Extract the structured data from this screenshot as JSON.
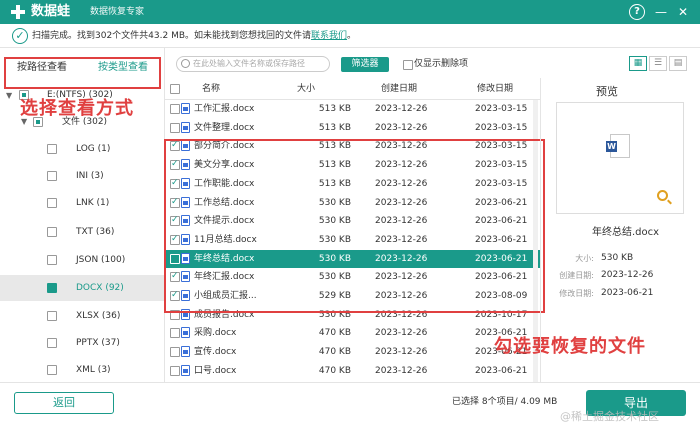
{
  "titlebar": {
    "app_name": "数据蛙",
    "app_sub": "数据恢复专家",
    "help": "?",
    "minimize": "—",
    "close": "✕"
  },
  "status": {
    "check": "✓",
    "text": "扫描完成。找到302个文件共43.2 MB。如未能找到您想找回的文件请",
    "link": "联系我们",
    "end": "。"
  },
  "tabs": {
    "by_path": "按路径查看",
    "by_type": "按类型查看"
  },
  "annotation_left": "选择查看方式",
  "annotation_right": "勾选要恢复的文件",
  "tree": {
    "drive": "E:(NTFS) (302)",
    "folder": "文件 (302)",
    "items": [
      {
        "label": "LOG (1)"
      },
      {
        "label": "INI (3)"
      },
      {
        "label": "LNK (1)"
      },
      {
        "label": "TXT (36)"
      },
      {
        "label": "JSON (100)"
      },
      {
        "label": "DOCX (92)"
      },
      {
        "label": "XLSX (36)"
      },
      {
        "label": "PPTX (37)"
      },
      {
        "label": "XML (3)"
      }
    ]
  },
  "toolbar": {
    "search_placeholder": "在此处输入文件名称或保存路径",
    "filter": "筛选器",
    "only_deleted": "仅显示删除项"
  },
  "table": {
    "headers": {
      "name": "名称",
      "size": "大小",
      "created": "创建日期",
      "modified": "修改日期"
    },
    "rows": [
      {
        "name": "工作汇报.docx",
        "size": "513 KB",
        "created": "2023-12-26",
        "modified": "2023-03-15",
        "checked": false
      },
      {
        "name": "文件整理.docx",
        "size": "513 KB",
        "created": "2023-12-26",
        "modified": "2023-03-15",
        "checked": false
      },
      {
        "name": "部分简介.docx",
        "size": "513 KB",
        "created": "2023-12-26",
        "modified": "2023-03-15",
        "checked": true
      },
      {
        "name": "美文分享.docx",
        "size": "513 KB",
        "created": "2023-12-26",
        "modified": "2023-03-15",
        "checked": true
      },
      {
        "name": "工作职能.docx",
        "size": "513 KB",
        "created": "2023-12-26",
        "modified": "2023-03-15",
        "checked": true
      },
      {
        "name": "工作总结.docx",
        "size": "530 KB",
        "created": "2023-12-26",
        "modified": "2023-06-21",
        "checked": true
      },
      {
        "name": "文件提示.docx",
        "size": "530 KB",
        "created": "2023-12-26",
        "modified": "2023-06-21",
        "checked": true
      },
      {
        "name": "11月总结.docx",
        "size": "530 KB",
        "created": "2023-12-26",
        "modified": "2023-06-21",
        "checked": true
      },
      {
        "name": "年终总结.docx",
        "size": "530 KB",
        "created": "2023-12-26",
        "modified": "2023-06-21",
        "checked": false,
        "selected": true
      },
      {
        "name": "年终汇报.docx",
        "size": "530 KB",
        "created": "2023-12-26",
        "modified": "2023-06-21",
        "checked": true
      },
      {
        "name": "小组成员汇报...",
        "size": "529 KB",
        "created": "2023-12-26",
        "modified": "2023-08-09",
        "checked": true
      },
      {
        "name": "成员报告.docx",
        "size": "530 KB",
        "created": "2023-12-26",
        "modified": "2023-10-17",
        "checked": false
      },
      {
        "name": "采购.docx",
        "size": "470 KB",
        "created": "2023-12-26",
        "modified": "2023-06-21",
        "checked": false
      },
      {
        "name": "宣传.docx",
        "size": "470 KB",
        "created": "2023-12-26",
        "modified": "2023-06-21",
        "checked": false
      },
      {
        "name": "口号.docx",
        "size": "470 KB",
        "created": "2023-12-26",
        "modified": "2023-06-21",
        "checked": false
      }
    ]
  },
  "preview": {
    "title": "预览",
    "doc_letter": "W",
    "file_name": "年终总结.docx",
    "size_label": "大小:",
    "size": "530 KB",
    "created_label": "创建日期:",
    "created": "2023-12-26",
    "modified_label": "修改日期:",
    "modified": "2023-06-21"
  },
  "bottom": {
    "back": "返回",
    "selected_info": "已选择 8个项目/ 4.09 MB",
    "export": "导出"
  },
  "watermark": "@稀土掘金技术社区",
  "colors": {
    "accent": "#1a9a8a",
    "annotation": "#e04040"
  }
}
